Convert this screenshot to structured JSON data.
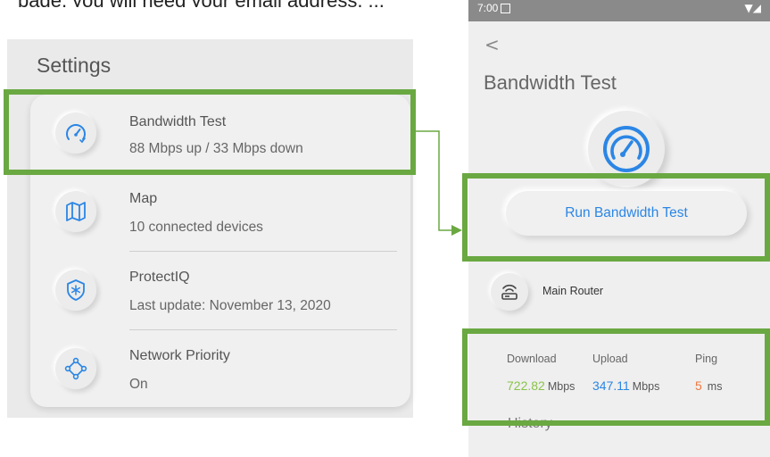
{
  "caption_partial": "page, you will need your email address, ...",
  "settings": {
    "title": "Settings",
    "items": [
      {
        "title": "Bandwidth Test",
        "subtitle": "88 Mbps up / 33 Mbps down",
        "icon": "speedometer-icon"
      },
      {
        "title": "Map",
        "subtitle": "10 connected devices",
        "icon": "map-icon"
      },
      {
        "title": "ProtectIQ",
        "subtitle": "Last update: November 13, 2020",
        "icon": "shield-icon"
      },
      {
        "title": "Network Priority",
        "subtitle": "On",
        "icon": "network-priority-icon"
      }
    ]
  },
  "phone": {
    "status_bar": {
      "time": "7:00"
    },
    "back_label": "<",
    "title": "Bandwidth Test",
    "run_button": "Run Bandwidth Test",
    "router": {
      "name": "Main Router"
    },
    "stats": {
      "headers": [
        "Download",
        "Upload",
        "Ping"
      ],
      "download": {
        "value": "722.82",
        "unit": "Mbps",
        "color": "#8bc34a"
      },
      "upload": {
        "value": "347.11",
        "unit": "Mbps",
        "color": "#2b86e5"
      },
      "ping": {
        "value": "5",
        "unit": "ms",
        "color": "#f0783c"
      }
    },
    "history_label": "History"
  },
  "colors": {
    "highlight": "#6aa842",
    "accent": "#2b86e5"
  }
}
